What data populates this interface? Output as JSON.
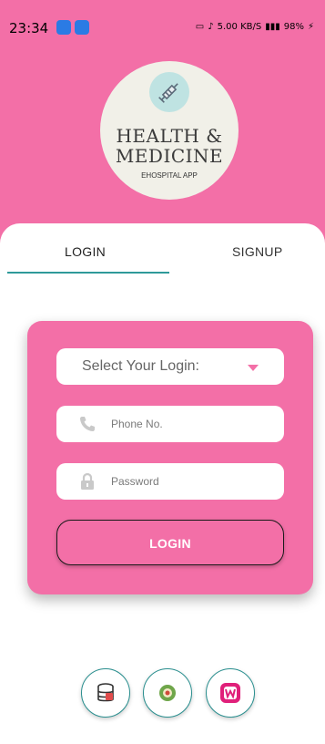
{
  "status_bar": {
    "time": "23:34",
    "right_text": "5.00 KB/S",
    "battery": "98%"
  },
  "logo": {
    "line1": "HEALTH &",
    "line2": "MEDICINE",
    "line3": "EHOSPITAL APP",
    "icon": "syringe-icon"
  },
  "tabs": {
    "login": "LOGIN",
    "signup": "SIGNUP"
  },
  "form": {
    "select_label": "Select Your Login:",
    "phone_placeholder": "Phone No.",
    "password_placeholder": "Password",
    "login_button": "LOGIN"
  },
  "bottom_icons": [
    "database-icon",
    "app-icon",
    "wamp-icon"
  ],
  "colors": {
    "primary_pink": "#f36fa7",
    "accent_teal": "#2e9a9a"
  }
}
